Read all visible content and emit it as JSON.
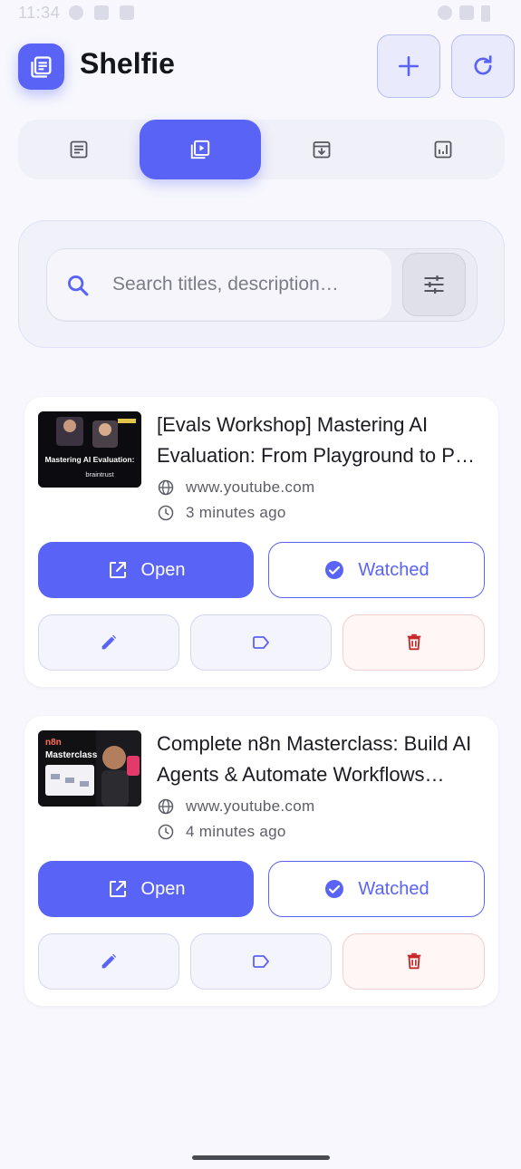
{
  "status_bar": {
    "time": "11:34"
  },
  "app": {
    "title": "Shelfie"
  },
  "colors": {
    "accent": "#5964f6",
    "danger": "#c62828",
    "background": "#f7f7fd"
  },
  "tabs": [
    {
      "id": "articles",
      "icon": "article-icon",
      "active": false
    },
    {
      "id": "videos",
      "icon": "video-library-icon",
      "active": true
    },
    {
      "id": "archive",
      "icon": "archive-icon",
      "active": false
    },
    {
      "id": "stats",
      "icon": "stats-icon",
      "active": false
    }
  ],
  "search": {
    "placeholder": "Search titles, description…",
    "value": ""
  },
  "items": [
    {
      "title": "[Evals Workshop] Mastering AI Evaluation: From Playground to P…",
      "domain": "www.youtube.com",
      "time": "3 minutes ago",
      "open_label": "Open",
      "watched_label": "Watched",
      "thumbnail": {
        "headline": "Mastering AI Evaluation:",
        "brand": "braintrust"
      }
    },
    {
      "title": "Complete n8n Masterclass: Build AI Agents & Automate Workflows…",
      "domain": "www.youtube.com",
      "time": "4 minutes ago",
      "open_label": "Open",
      "watched_label": "Watched",
      "thumbnail": {
        "headline": "n8n",
        "brand": "Masterclass"
      }
    }
  ]
}
